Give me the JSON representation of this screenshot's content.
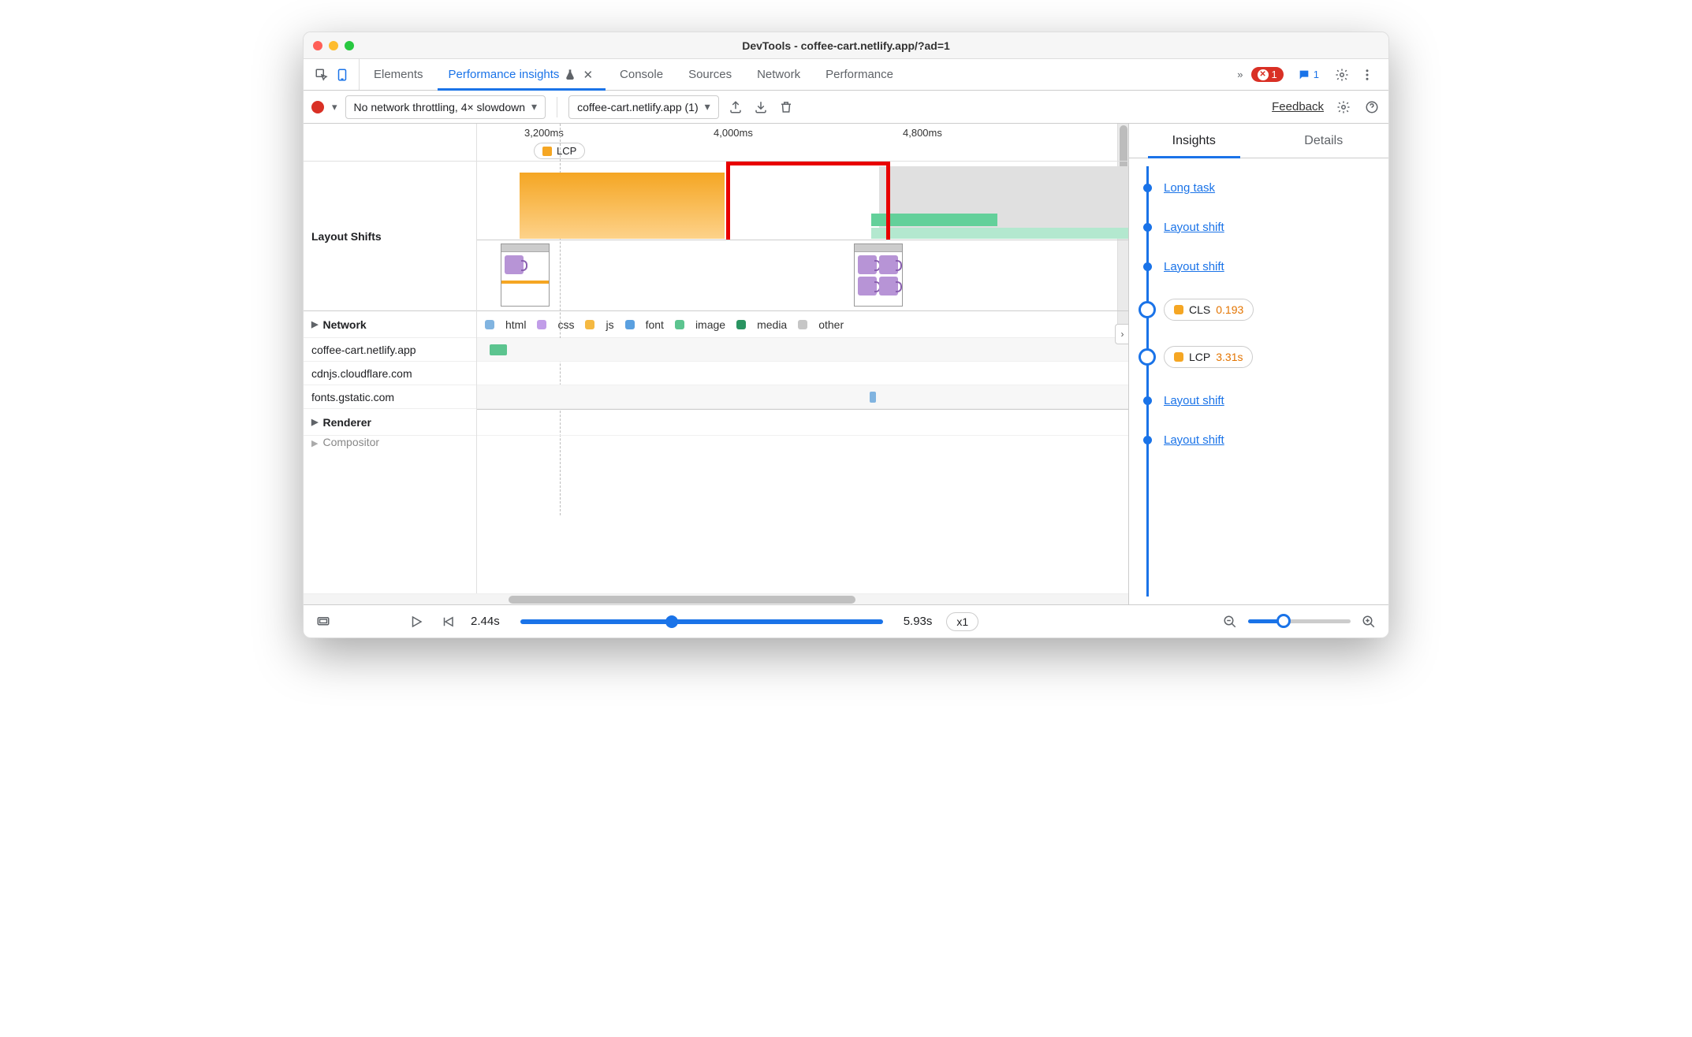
{
  "window": {
    "title": "DevTools - coffee-cart.netlify.app/?ad=1"
  },
  "tabs": {
    "elements": "Elements",
    "perf_insights": "Performance insights",
    "console": "Console",
    "sources": "Sources",
    "network": "Network",
    "performance": "Performance",
    "overflow": "»",
    "error_badge": "1",
    "message_badge": "1"
  },
  "toolbar": {
    "throttling_select": "No network throttling, 4× slowdown",
    "recording_select": "coffee-cart.netlify.app (1)",
    "feedback": "Feedback"
  },
  "ruler": {
    "t1": "3,200ms",
    "t2": "4,000ms",
    "t3": "4,800ms",
    "lcp_label": "LCP"
  },
  "rows": {
    "layout_shifts": "Layout Shifts",
    "network": "Network",
    "renderer": "Renderer",
    "compositor": "Compositor"
  },
  "net_legend": {
    "html": "html",
    "css": "css",
    "js": "js",
    "font": "font",
    "image": "image",
    "media": "media",
    "other": "other"
  },
  "net_hosts": {
    "h1": "coffee-cart.netlify.app",
    "h2": "cdnjs.cloudflare.com",
    "h3": "fonts.gstatic.com"
  },
  "video": {
    "start": "2.44s",
    "end": "5.93s",
    "speed": "x1"
  },
  "sidebar": {
    "tab_insights": "Insights",
    "tab_details": "Details",
    "items": {
      "long_task": "Long task",
      "layout_shift": "Layout shift",
      "cls_label": "CLS",
      "cls_value": "0.193",
      "lcp_label": "LCP",
      "lcp_value": "3.31s"
    }
  }
}
